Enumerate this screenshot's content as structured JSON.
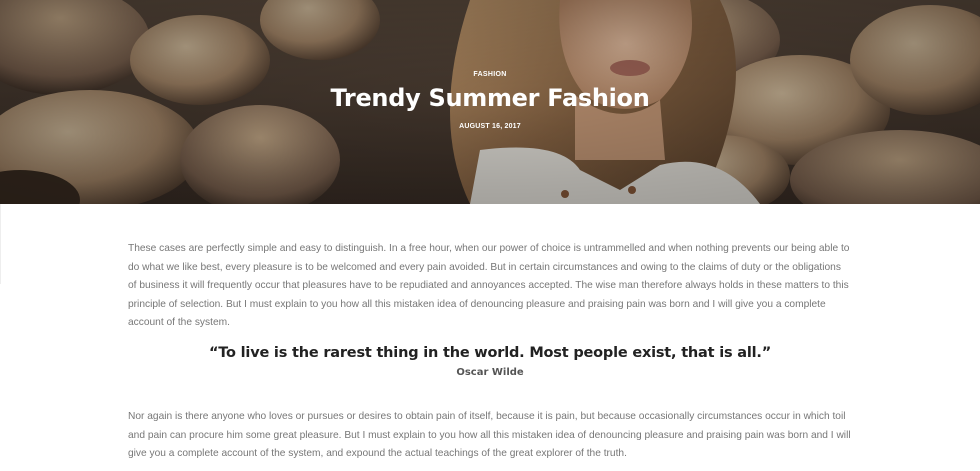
{
  "hero": {
    "category": "FASHION",
    "title": "Trendy Summer Fashion",
    "date": "AUGUST 16, 2017"
  },
  "article": {
    "paragraph_1": "These cases are perfectly simple and easy to distinguish. In a free hour, when our power of choice is untrammelled and when nothing prevents our being able to do what we like best, every pleasure is to be welcomed and every pain avoided. But in certain circumstances and owing to the claims of duty or the obligations of business it will frequently occur that pleasures have to be repudiated and annoyances accepted. The wise man therefore always holds in these matters to this principle of selection. But I must explain to you how all this mistaken idea of denouncing pleasure and praising pain was born and I will give you a complete account of the system.",
    "quote": "“To live is the rarest thing in the world. Most people exist, that is all.”",
    "quote_author": "Oscar Wilde",
    "paragraph_2": "Nor again is there anyone who loves or pursues or desires to obtain pain of itself, because it is pain, but because occasionally circumstances occur in which toil and pain can procure him some great pleasure. But I must explain to you how all this mistaken idea of denouncing pleasure and praising pain was born and I will give you a complete account of the system, and expound the actual teachings of the great explorer of the truth."
  },
  "colors": {
    "hero_overlay_text": "#ffffff",
    "body_text": "#777777",
    "quote_text": "#222222",
    "author_text": "#555555"
  }
}
